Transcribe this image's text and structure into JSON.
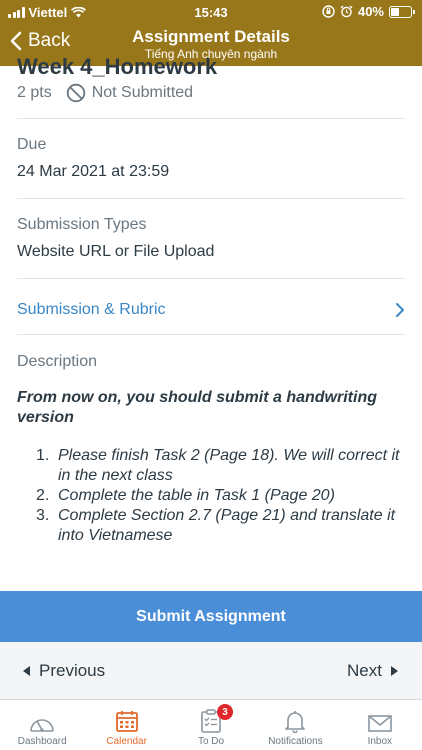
{
  "status_bar": {
    "carrier": "Viettel",
    "time": "15:43",
    "battery": "40%",
    "battery_level": 0.4
  },
  "nav": {
    "back_label": "Back",
    "title": "Assignment Details",
    "subtitle": "Tiếng Anh chuyên ngành"
  },
  "assignment": {
    "title": "Week 4_Homework",
    "points": "2 pts",
    "submission_status": "Not Submitted",
    "due_label": "Due",
    "due_value": "24 Mar 2021 at 23:59",
    "types_label": "Submission Types",
    "types_value": "Website URL or File Upload",
    "rubric_link": "Submission & Rubric",
    "description_label": "Description",
    "description_heading": "From now on, you should submit a handwriting version",
    "description_items": [
      {
        "num": "1.",
        "text": "Please finish Task 2 (Page 18). We will correct it in the next class"
      },
      {
        "num": "2.",
        "text": "Complete the table in Task 1 (Page 20)"
      },
      {
        "num": "3.",
        "text": "Complete Section 2.7 (Page 21) and translate it into Vietnamese"
      }
    ]
  },
  "actions": {
    "submit_label": "Submit Assignment",
    "previous_label": "Previous",
    "next_label": "Next"
  },
  "tabbar": {
    "tabs": [
      {
        "label": "Dashboard",
        "icon": "dashboard-icon",
        "active": false
      },
      {
        "label": "Calendar",
        "icon": "calendar-icon",
        "active": true
      },
      {
        "label": "To Do",
        "icon": "todo-icon",
        "active": false,
        "badge": "3"
      },
      {
        "label": "Notifications",
        "icon": "bell-icon",
        "active": false
      },
      {
        "label": "Inbox",
        "icon": "inbox-icon",
        "active": false
      }
    ]
  },
  "colors": {
    "header_bg": "#98771a",
    "link": "#3a87c6",
    "submit_bg": "#4b8ed8",
    "active_tab": "#e36a2b",
    "badge": "#e0262b"
  }
}
